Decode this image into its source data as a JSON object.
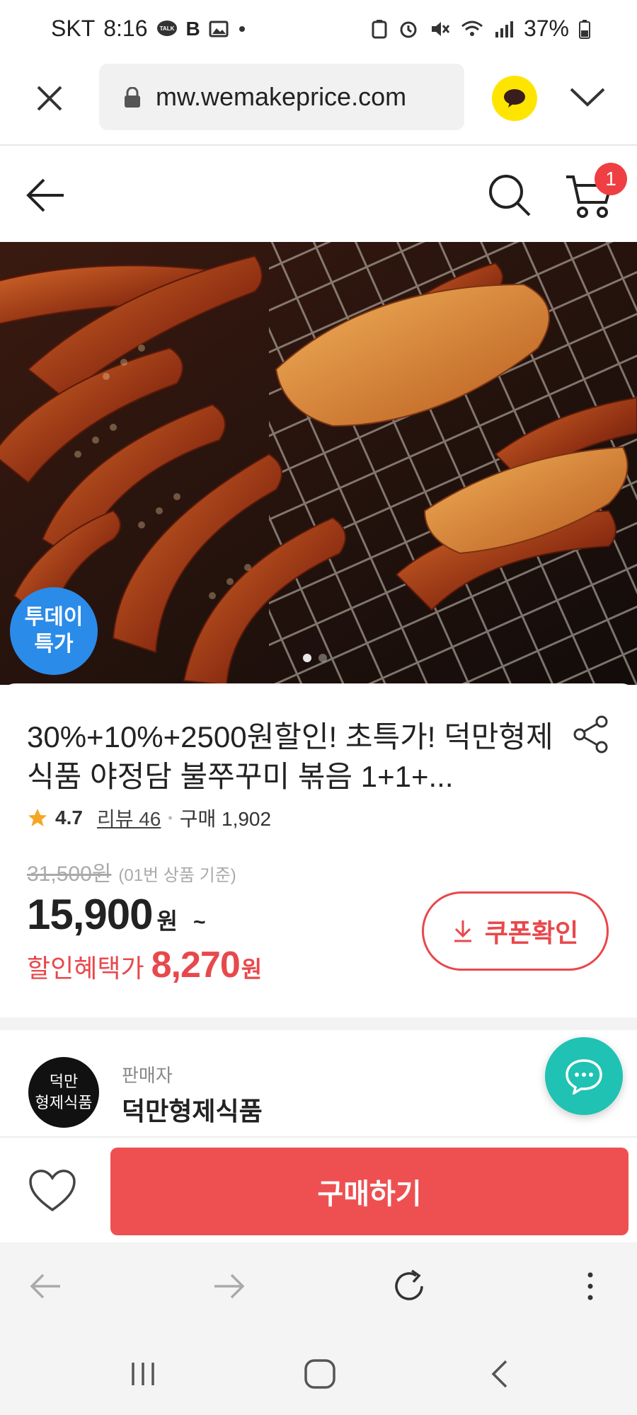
{
  "status_bar": {
    "carrier": "SKT",
    "time": "8:16",
    "battery": "37%",
    "left_icons": [
      "talk-icon",
      "b-icon",
      "image-icon",
      "dot-icon"
    ],
    "right_icons": [
      "recycle-icon",
      "alarm-icon",
      "mute-icon",
      "wifi-icon",
      "signal-icon",
      "battery-icon"
    ]
  },
  "browser": {
    "url": "mw.wemakeprice.com"
  },
  "header": {
    "cart_count": "1"
  },
  "product": {
    "badge_line1": "투데이",
    "badge_line2": "특가",
    "title": "30%+10%+2500원할인! 초특가! 덕만형제식품 야정담 불쭈꾸미 볶음 1+1+...",
    "rating": "4.7",
    "review_text": "리뷰 46",
    "purchase_text": "구매 1,902",
    "original_price": "31,500원",
    "original_note": "(01번 상품 기준)",
    "price": "15,900",
    "price_unit": "원",
    "price_tilde": "~",
    "discount_label": "할인혜택가",
    "discount_price": "8,270",
    "discount_unit": "원",
    "coupon_label": "쿠폰확인"
  },
  "seller": {
    "label": "판매자",
    "name": "덕만형제식품",
    "logo_line1": "덕만",
    "logo_line2": "형제식품"
  },
  "purchase": {
    "buy_label": "구매하기"
  },
  "colors": {
    "accent_red": "#ee5051",
    "badge_blue": "#2a8be9",
    "chat_teal": "#1fc2b3",
    "kakao_yellow": "#fee500"
  }
}
